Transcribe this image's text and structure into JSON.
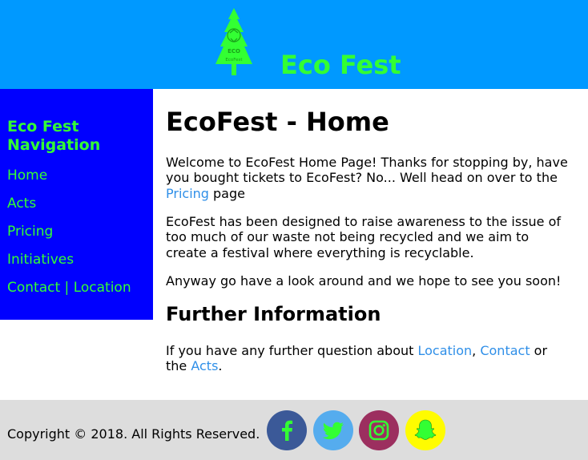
{
  "header": {
    "logo_text": "EcoFest",
    "brand_title": "Eco Fest"
  },
  "sidebar": {
    "title": "Eco Fest Navigation",
    "items": [
      {
        "label": "Home"
      },
      {
        "label": "Acts"
      },
      {
        "label": "Pricing"
      },
      {
        "label": "Initiatives"
      },
      {
        "label": "Contact"
      },
      {
        "label": "Location"
      }
    ],
    "separator": "|"
  },
  "main": {
    "heading": "EcoFest - Home",
    "intro_before": "Welcome to EcoFest Home Page! Thanks for stopping by, have you bought tickets to EcoFest? No... Well head on over to the ",
    "intro_link": "Pricing",
    "intro_after": " page",
    "para2": "EcoFest has been designed to raise awareness to the issue of too much of our waste not being recycled and we aim to create a festival where everything is recyclable.",
    "para3": "Anyway go have a look around and we hope to see you soon!",
    "subheading": "Further Information",
    "info_before": "If you have any further question about ",
    "info_link_location": "Location",
    "info_comma": ", ",
    "info_link_contact": "Contact",
    "info_mid": " or the ",
    "info_link_acts": "Acts",
    "info_end": "."
  },
  "footer": {
    "copyright": "Copyright © 2018. All Rights Reserved.",
    "social": [
      {
        "name": "facebook-icon",
        "color": "#3b5998"
      },
      {
        "name": "twitter-icon",
        "color": "#55acee"
      },
      {
        "name": "instagram-icon",
        "color": "#9c2f5f"
      },
      {
        "name": "snapchat-icon",
        "color": "#fffc00"
      }
    ]
  },
  "colors": {
    "header_bg": "#0099ff",
    "sidebar_bg": "#0000ff",
    "accent_green": "#33ff33",
    "link_blue": "#2f8fe8",
    "footer_bg": "#dddddd"
  }
}
